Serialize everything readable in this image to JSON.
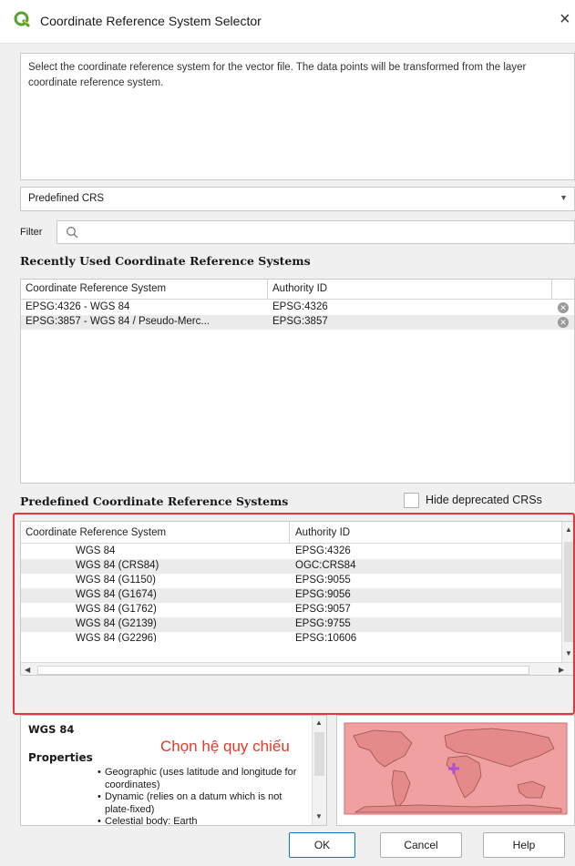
{
  "window": {
    "title": "Coordinate Reference System Selector",
    "close_glyph": "×"
  },
  "description": "Select the coordinate reference system for the vector file. The data points will be transformed from the layer coordinate reference system.",
  "crs_type": {
    "selected": "Predefined CRS"
  },
  "filter": {
    "label": "Filter",
    "value": ""
  },
  "recent": {
    "title": "Recently Used Coordinate Reference Systems",
    "headers": [
      "Coordinate Reference System",
      "Authority ID"
    ],
    "rows": [
      {
        "name": "EPSG:4326 - WGS 84",
        "id": "EPSG:4326"
      },
      {
        "name": "EPSG:3857 - WGS 84 / Pseudo-Merc...",
        "id": "EPSG:3857"
      }
    ]
  },
  "predefined": {
    "title": "Predefined Coordinate Reference Systems",
    "hide_deprecated_label": "Hide deprecated CRSs",
    "hide_deprecated_checked": false,
    "headers": [
      "Coordinate Reference System",
      "Authority ID"
    ],
    "rows": [
      {
        "name": "WGS 84",
        "id": "EPSG:4326"
      },
      {
        "name": "WGS 84 (CRS84)",
        "id": "OGC:CRS84"
      },
      {
        "name": "WGS 84 (G1150)",
        "id": "EPSG:9055"
      },
      {
        "name": "WGS 84 (G1674)",
        "id": "EPSG:9056"
      },
      {
        "name": "WGS 84 (G1762)",
        "id": "EPSG:9057"
      },
      {
        "name": "WGS 84 (G2139)",
        "id": "EPSG:9755"
      },
      {
        "name": "WGS 84 (G2296)",
        "id": "EPSG:10606"
      }
    ]
  },
  "info": {
    "crs_name": "WGS 84",
    "properties_heading": "Properties",
    "annotation": "Chọn hệ quy chiếu",
    "properties": [
      "Geographic (uses latitude and longitude for coordinates)",
      "Dynamic (relies on a datum which is not plate-fixed)",
      "Celestial body: Earth"
    ]
  },
  "buttons": {
    "ok": "OK",
    "cancel": "Cancel",
    "help": "Help"
  },
  "colors": {
    "highlight_frame": "#e23a3a",
    "annotation": "#e33a2a",
    "map_extent": "#f0a0a0",
    "crosshair": "#b050d0",
    "qgis_green": "#58a430"
  }
}
